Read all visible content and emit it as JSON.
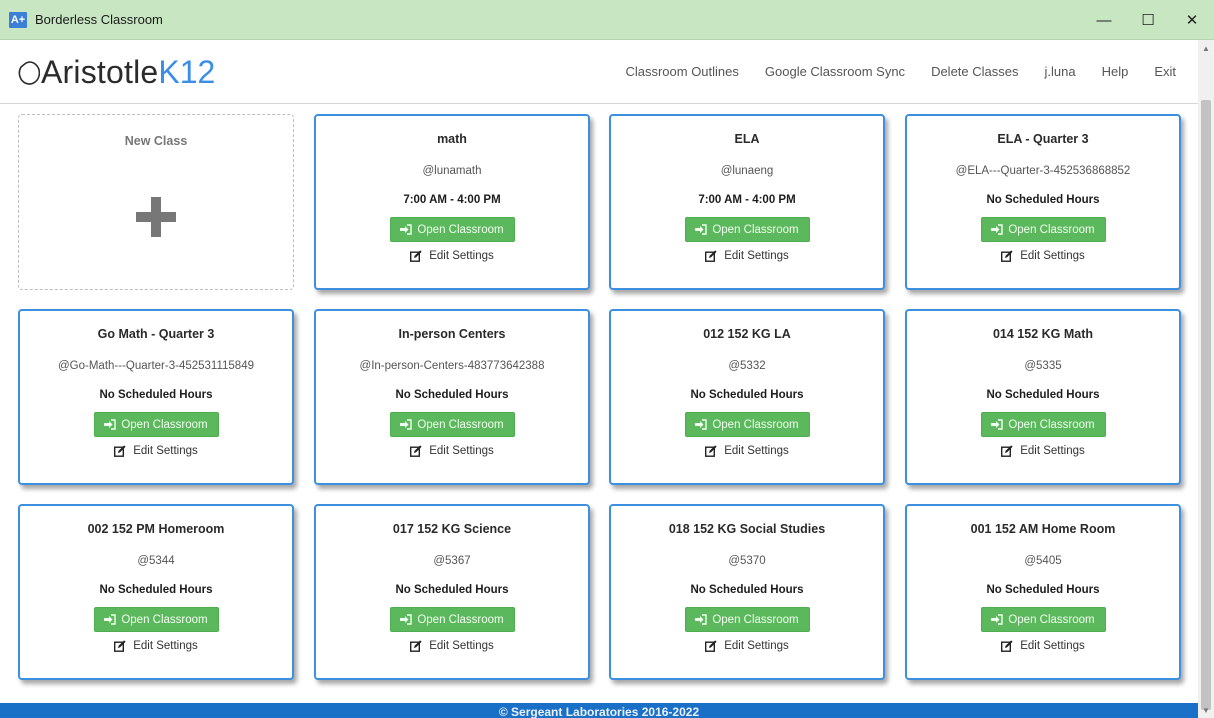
{
  "window": {
    "icon_label": "A+",
    "title": "Borderless Classroom",
    "minimize": "—",
    "maximize": "☐",
    "close": "✕"
  },
  "header": {
    "logo_main": "Aristotle",
    "logo_accent": "K12",
    "nav": [
      {
        "label": "Classroom Outlines"
      },
      {
        "label": "Google Classroom Sync"
      },
      {
        "label": "Delete Classes"
      },
      {
        "label": "j.luna"
      },
      {
        "label": "Help"
      },
      {
        "label": "Exit"
      }
    ]
  },
  "new_class": {
    "label": "New Class"
  },
  "card_labels": {
    "open": "Open Classroom",
    "edit": "Edit Settings"
  },
  "classes": [
    {
      "title": "math",
      "handle": "@lunamath",
      "hours": "7:00 AM - 4:00 PM"
    },
    {
      "title": "ELA",
      "handle": "@lunaeng",
      "hours": "7:00 AM - 4:00 PM"
    },
    {
      "title": "ELA - Quarter 3",
      "handle": "@ELA---Quarter-3-452536868852",
      "hours": "No Scheduled Hours"
    },
    {
      "title": "Go Math - Quarter 3",
      "handle": "@Go-Math---Quarter-3-452531115849",
      "hours": "No Scheduled Hours"
    },
    {
      "title": "In-person Centers",
      "handle": "@In-person-Centers-483773642388",
      "hours": "No Scheduled Hours"
    },
    {
      "title": "012 152 KG LA",
      "handle": "@5332",
      "hours": "No Scheduled Hours"
    },
    {
      "title": "014 152 KG Math",
      "handle": "@5335",
      "hours": "No Scheduled Hours"
    },
    {
      "title": "002 152 PM Homeroom",
      "handle": "@5344",
      "hours": "No Scheduled Hours"
    },
    {
      "title": "017 152 KG Science",
      "handle": "@5367",
      "hours": "No Scheduled Hours"
    },
    {
      "title": "018 152 KG Social Studies",
      "handle": "@5370",
      "hours": "No Scheduled Hours"
    },
    {
      "title": "001 152 AM Home Room",
      "handle": "@5405",
      "hours": "No Scheduled Hours"
    }
  ],
  "footer": {
    "text": "© Sergeant Laboratories 2016-2022"
  },
  "colors": {
    "accent": "#3d8fe0",
    "button": "#5cb85c",
    "titlebar": "#c8e6c2",
    "footer": "#1a6fc7"
  }
}
